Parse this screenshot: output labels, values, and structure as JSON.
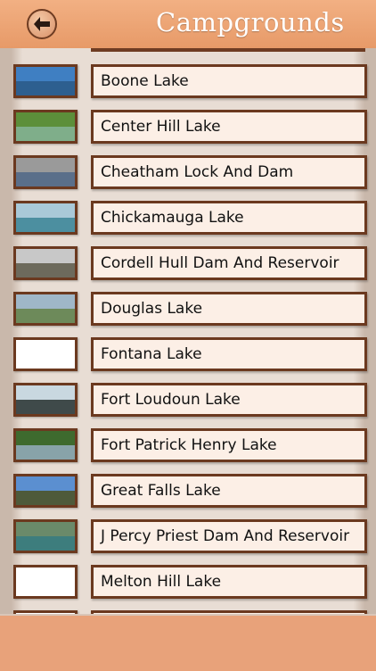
{
  "header": {
    "title": "Campgrounds"
  },
  "items": [
    {
      "label": "Boone Lake",
      "thumb": [
        "#3f7fc2",
        "#2d5f8f"
      ]
    },
    {
      "label": "Center Hill Lake",
      "thumb": [
        "#5c8f3a",
        "#7fae8a"
      ]
    },
    {
      "label": "Cheatham Lock And Dam",
      "thumb": [
        "#9a9a9a",
        "#5a6f8a"
      ]
    },
    {
      "label": "Chickamauga Lake",
      "thumb": [
        "#a9c9d8",
        "#4c8fa0"
      ]
    },
    {
      "label": "Cordell Hull Dam And Reservoir",
      "thumb": [
        "#c8c8c8",
        "#6d6a5c"
      ]
    },
    {
      "label": "Douglas Lake",
      "thumb": [
        "#9fb7c8",
        "#6d8a5a"
      ]
    },
    {
      "label": "Fontana Lake",
      "thumb": [
        "#ffffff",
        "#ffffff"
      ]
    },
    {
      "label": "Fort Loudoun Lake",
      "thumb": [
        "#c9d8e0",
        "#3f4a4a"
      ]
    },
    {
      "label": "Fort Patrick Henry Lake",
      "thumb": [
        "#3e6a2e",
        "#88a3a9"
      ]
    },
    {
      "label": "Great Falls Lake",
      "thumb": [
        "#5b8fd0",
        "#4e5a3a"
      ]
    },
    {
      "label": "J Percy Priest Dam And Reservoir",
      "thumb": [
        "#6a8a6a",
        "#3d7d7d"
      ]
    },
    {
      "label": "Melton Hill Lake",
      "thumb": [
        "#ffffff",
        "#ffffff"
      ]
    },
    {
      "label": "",
      "thumb": [
        "#ffffff",
        "#ffffff"
      ]
    }
  ]
}
